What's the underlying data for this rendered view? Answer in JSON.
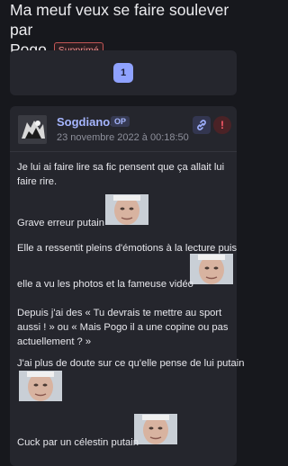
{
  "topic": {
    "title_line1": "Ma meuf veux se faire soulever par",
    "title_line2": "Pogo",
    "deleted_badge": "Supprimé"
  },
  "pagination": {
    "current_page": "1"
  },
  "post": {
    "author": "Sogdianos",
    "author_badge": "OP",
    "date": "23 novembre 2022 à 00:18:50",
    "link_icon": "link-icon",
    "report_icon": "alert-icon",
    "report_glyph": "!",
    "lines": [
      "Je lui ai faire lire sa fic pensent que ça allait lui",
      "faire rire.",
      "Grave erreur putain",
      "Elle a ressentit pleins d'émotions à la lecture puis",
      "elle a vu les photos et la fameuse vidéo",
      "Depuis j'ai des « Tu devrais te mettre au sport",
      "aussi ! » ou « Mais Pogo il a une copine ou pas",
      "actuellement ? »",
      "J'ai plus de doute sur ce qu'elle pense de lui putain",
      "Cuck par un célestin putain"
    ]
  },
  "colors": {
    "background": "#17181d",
    "card": "#25262d",
    "accent": "#8fa2ff",
    "author": "#a6b6ff",
    "danger": "#ff5a6a"
  }
}
